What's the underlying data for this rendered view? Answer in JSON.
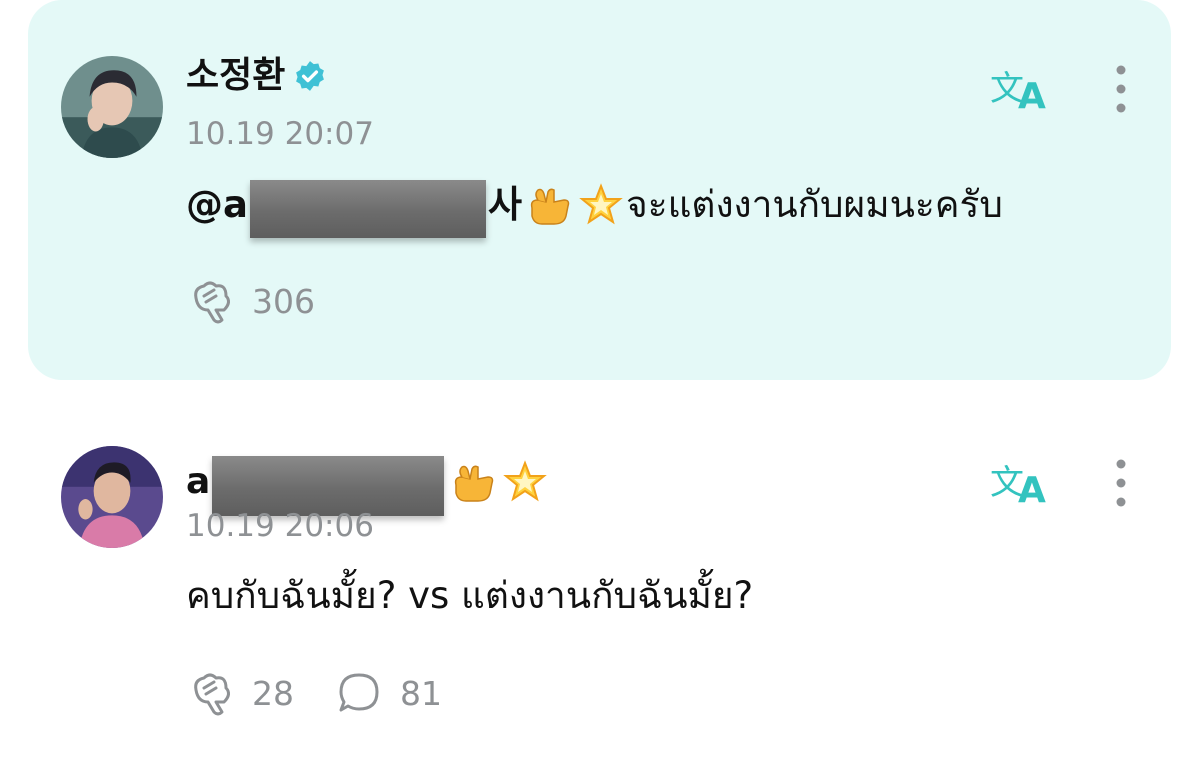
{
  "colors": {
    "accent": "#33c3bf",
    "highlight_bg": "#e4f9f7",
    "muted": "#8e9194",
    "verified": "#3fc1d5"
  },
  "posts": [
    {
      "author": "소정환",
      "verified": true,
      "timestamp": "10.19 20:07",
      "body_prefix": "@a",
      "body_suffix": "사",
      "emojis": [
        "call-me-hand-emoji",
        "glowing-star-emoji"
      ],
      "body_text": " จะแต่งงานกับผมนะครับ",
      "likes": "306",
      "icons": {
        "translate": "translate-icon",
        "more": "more-vertical-icon",
        "like": "like-icon"
      }
    },
    {
      "author_prefix": "a",
      "author_suffix": "",
      "emojis": [
        "call-me-hand-emoji",
        "glowing-star-emoji"
      ],
      "timestamp": "10.19 20:06",
      "body_text": "คบกับฉันมั้ย? vs แต่งงานกับฉันมั้ย?",
      "likes": "28",
      "comments": "81",
      "icons": {
        "translate": "translate-icon",
        "more": "more-vertical-icon",
        "like": "like-icon",
        "comment": "comment-icon"
      }
    }
  ]
}
